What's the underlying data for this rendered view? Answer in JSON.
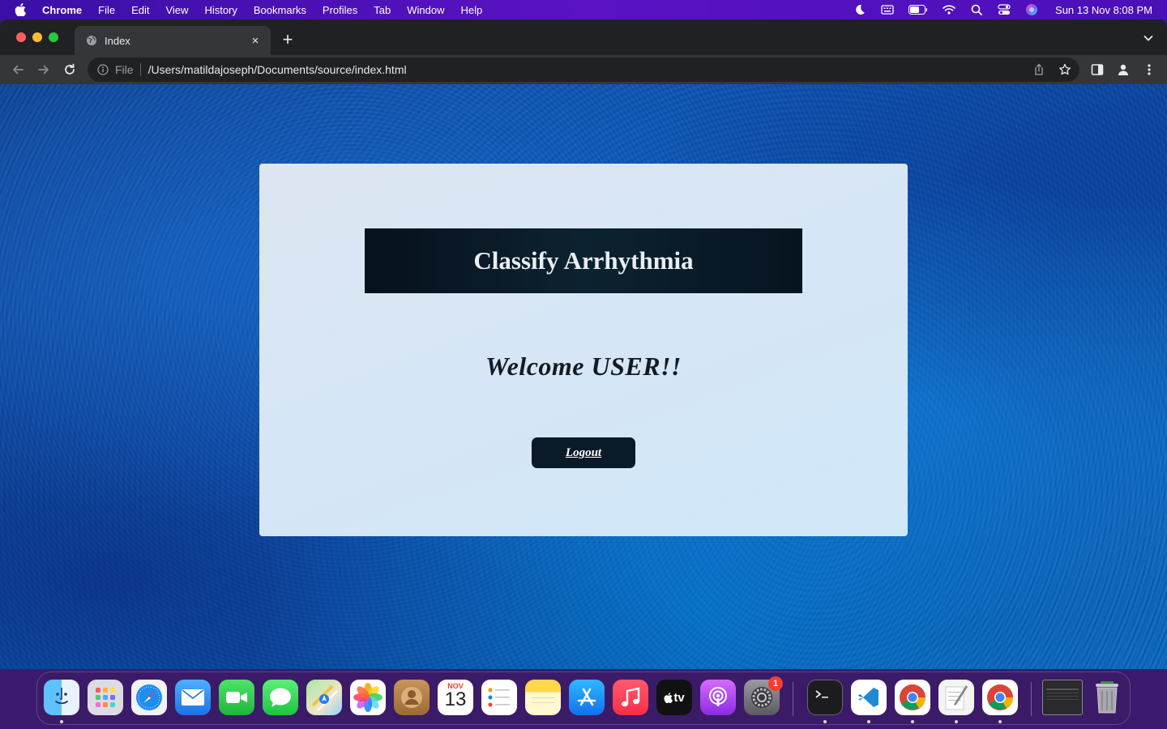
{
  "menubar": {
    "app_name": "Chrome",
    "items": [
      "File",
      "Edit",
      "View",
      "History",
      "Bookmarks",
      "Profiles",
      "Tab",
      "Window",
      "Help"
    ],
    "clock": "Sun 13 Nov  8:08 PM"
  },
  "browser": {
    "tab_title": "Index",
    "tab_close": "×",
    "new_tab": "+",
    "omnibox": {
      "scheme_label": "File",
      "url": "/Users/matildajoseph/Documents/source/index.html"
    }
  },
  "page": {
    "heading": "Classify Arrhythmia",
    "welcome": "Welcome USER!!",
    "logout_label": "Logout"
  },
  "dock": {
    "calendar_month": "NOV",
    "calendar_day": "13",
    "settings_badge": "1",
    "tv_label": "tv"
  }
}
